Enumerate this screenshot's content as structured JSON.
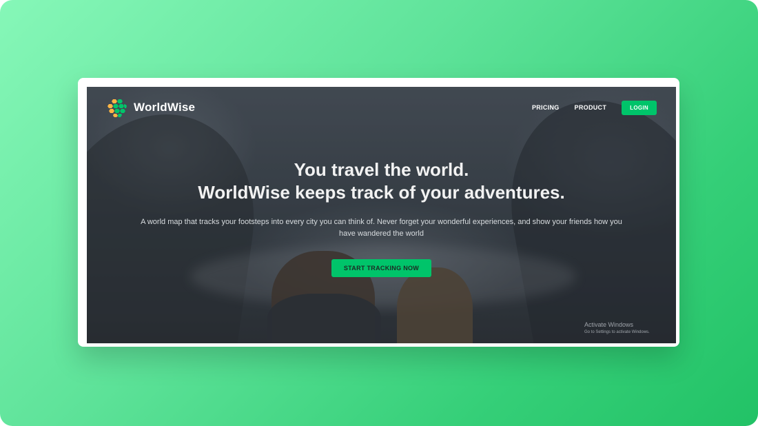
{
  "brand": {
    "name": "WorldWise",
    "icon": "globe-hexagon-logo-icon"
  },
  "nav": {
    "links": [
      "PRICING",
      "PRODUCT"
    ],
    "login_label": "LOGIN"
  },
  "hero": {
    "title_line1": "You travel the world.",
    "title_line2": "WorldWise keeps track of your adventures.",
    "subtitle": "A world map that tracks your footsteps into every city you can think of. Never forget your wonderful experiences, and show your friends how you have wandered the world",
    "cta_label": "START TRACKING NOW"
  },
  "watermark": {
    "title": "Activate Windows",
    "subtitle": "Go to Settings to activate Windows."
  },
  "colors": {
    "accent": "#00c46a",
    "backdrop_start": "#86f7b8",
    "backdrop_end": "#22c266"
  }
}
